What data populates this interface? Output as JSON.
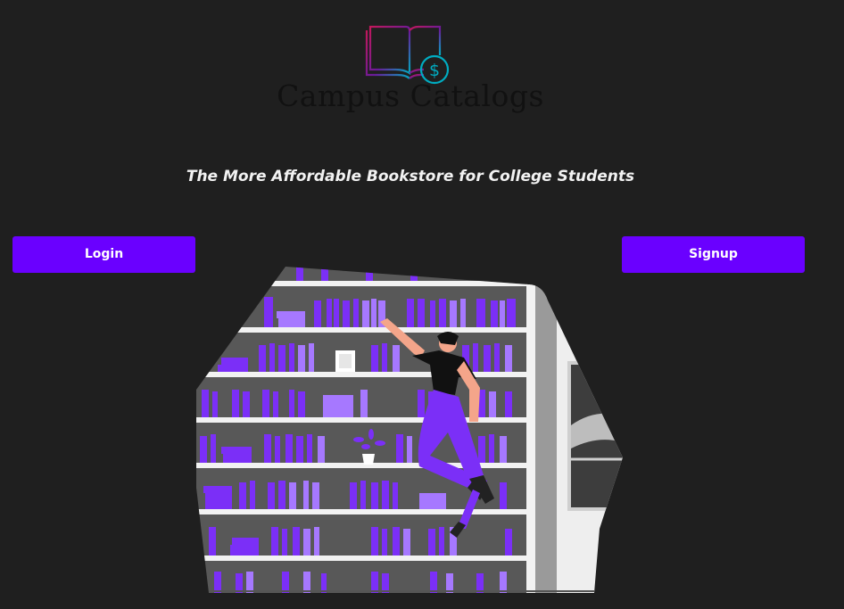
{
  "brand": {
    "name": "Campus Catalogs",
    "logo_icon": "book-dollar-icon"
  },
  "tagline": "The More Affordable Bookstore for College Students",
  "actions": {
    "login_label": "Login",
    "signup_label": "Signup"
  },
  "hero": {
    "illustration": "person-reaching-bookshelf-illustration"
  },
  "colors": {
    "background": "#1f1f1f",
    "accent": "#6a00ff",
    "text_light": "#f2f2f2",
    "brand_text": "#111111"
  }
}
